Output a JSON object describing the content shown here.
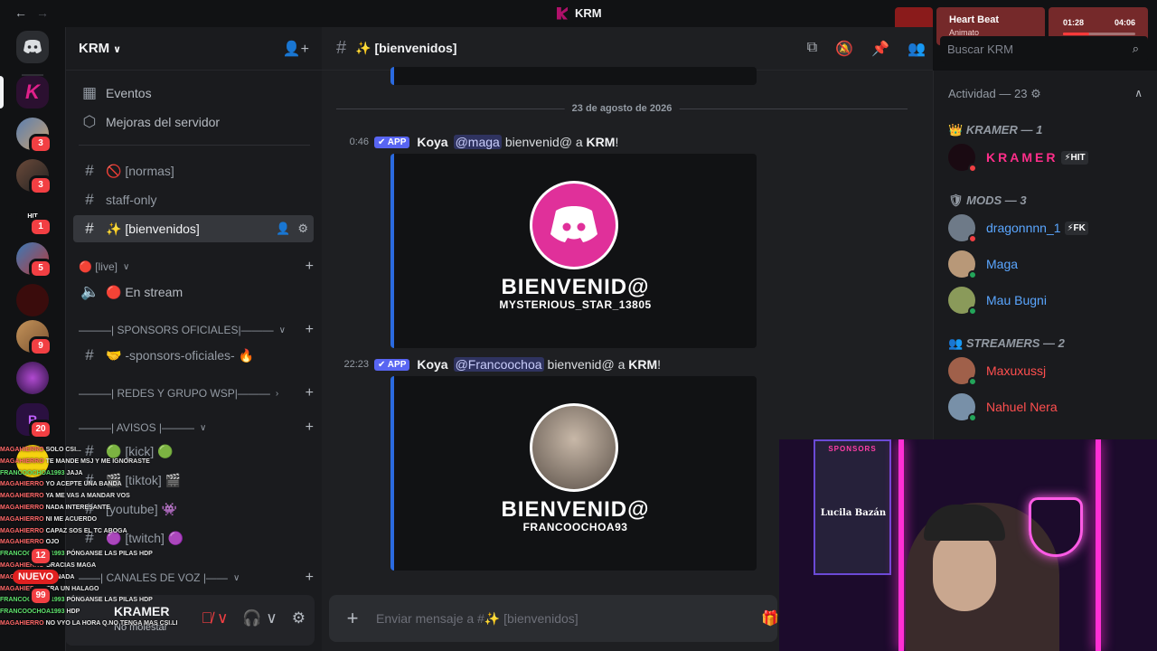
{
  "window": {
    "title": "KRM"
  },
  "music": {
    "title": "Heart Beat",
    "artist": "Animato",
    "current": "01:28",
    "total": "04:06",
    "progress": 0.36
  },
  "rail": {
    "badges": [
      "3",
      "3",
      "1",
      "5",
      "9",
      "20",
      "12",
      "99"
    ],
    "nuevo": "NUEVO"
  },
  "sidebar": {
    "server_name": "KRM",
    "items": [
      {
        "icon": "calendar-icon",
        "label": "Eventos"
      },
      {
        "icon": "shield-icon",
        "label": "Mejoras del servidor"
      }
    ],
    "channels": [
      {
        "label": "🚫 [normas]"
      },
      {
        "label": "staff-only"
      },
      {
        "label": "✨ [bienvenidos]"
      }
    ],
    "live_category": "🔴 [live]",
    "stream_channel": "🔴 En stream",
    "sponsors_category": "———| SPONSORS OFICIALES|———",
    "sponsors_channel": "🤝 -sponsors-oficiales- 🔥",
    "redes_category": "———| REDES Y GRUPO WSP|———",
    "avisos_category": "———| AVISOS |———",
    "avisos_channels": [
      {
        "label": "🟢 [kick] 🟢"
      },
      {
        "label": "🎬 [tiktok] 🎬"
      },
      {
        "label": "[youtube] 👾"
      },
      {
        "label": "🟣 [twitch] 🟣"
      }
    ],
    "voice_category": "——| CANALES DE VOZ |——"
  },
  "user": {
    "name": "KRAMER",
    "status": "No molestar"
  },
  "chat_overlay": [
    {
      "user": "MAGAHIERRO",
      "text": "SOLO CSI..."
    },
    {
      "user": "MAGAHIERRO",
      "text": "TE MANDE MSJ Y ME IGNORASTE"
    },
    {
      "user": "FRANCOOCHOA1993",
      "text": "JAJA"
    },
    {
      "user": "MAGAHIERRO",
      "text": "YO ACEPTE UNA BANDA"
    },
    {
      "user": "MAGAHIERRO",
      "text": "YA ME VAS A MANDAR VOS"
    },
    {
      "user": "MAGAHIERRO",
      "text": "NADA INTERESANTE"
    },
    {
      "user": "MAGAHIERRO",
      "text": "NI ME ACUERDO"
    },
    {
      "user": "MAGAHIERRO",
      "text": "CAPAZ SOS EL TC ABOGA"
    },
    {
      "user": "MAGAHIERRO",
      "text": "OJO"
    },
    {
      "user": "FRANCOOCHOA1993",
      "text": "PÓNGANSE LAS PILAS HDP"
    },
    {
      "user": "MAGAHIERRO",
      "text": "GRACIAS MAGA"
    },
    {
      "user": "MAGAHIERRO",
      "text": "DE NADA"
    },
    {
      "user": "MAGAHIERRO",
      "text": "ERA UN HALAGO"
    },
    {
      "user": "FRANCOOCHOA1993",
      "text": "PÓNGANSE LAS PILAS HDP"
    },
    {
      "user": "FRANCOOCHOA1993",
      "text": "HDP"
    },
    {
      "user": "MAGAHIERRO",
      "text": "NO VYO LA HORA Q.NO TENGA MAS CSI.LI"
    }
  ],
  "main": {
    "channel_name": "✨ [bienvenidos]",
    "date_divider": "23 de agosto de 2026",
    "messages": [
      {
        "time": "0:46",
        "badge": "APP",
        "author": "Koya",
        "mention": "@maga",
        "text_before": "bienvenid@ a ",
        "text_bold": "KRM",
        "text_after": "!",
        "card_title": "BIENVENID@",
        "card_sub": "MYSTERIOUS_STAR_13805"
      },
      {
        "time": "22:23",
        "badge": "APP",
        "author": "Koya",
        "mention": "@Francoochoa",
        "text_before": "bienvenid@ a ",
        "text_bold": "KRM",
        "text_after": "!",
        "card_title": "BIENVENID@",
        "card_sub": "FRANCOOCHOA93"
      }
    ],
    "composer_placeholder": "Enviar mensaje a #✨ [bienvenidos]"
  },
  "search": {
    "placeholder": "Buscar KRM"
  },
  "members": {
    "activity": "Actividad — 23",
    "sections": [
      {
        "title": "KRAMER — 1",
        "members": [
          {
            "name": "KRAMER",
            "tag": "⚡HIT",
            "color": "#ff2e8a"
          }
        ]
      },
      {
        "title": "MODS — 3",
        "members": [
          {
            "name": "dragonnnn_1",
            "tag": "⚡FK",
            "color": "#5aa6ff"
          },
          {
            "name": "Maga",
            "tag": "",
            "color": "#5aa6ff"
          },
          {
            "name": "Mau Bugni",
            "tag": "",
            "color": "#5aa6ff"
          }
        ]
      },
      {
        "title": "STREAMERS — 2",
        "members": [
          {
            "name": "Maxuxussj",
            "tag": "",
            "color": "#ff4f4f"
          },
          {
            "name": "Nahuel Nera",
            "tag": "",
            "color": "#ff4f4f"
          }
        ]
      }
    ]
  },
  "webcam": {
    "sponsors_label": "SPONSORS",
    "sponsor_name": "Lucila Bazán"
  },
  "colors": {
    "accent": "#5865f2",
    "embed_border": "#2a6ae0",
    "danger": "#f23f43",
    "online": "#23a55a"
  }
}
